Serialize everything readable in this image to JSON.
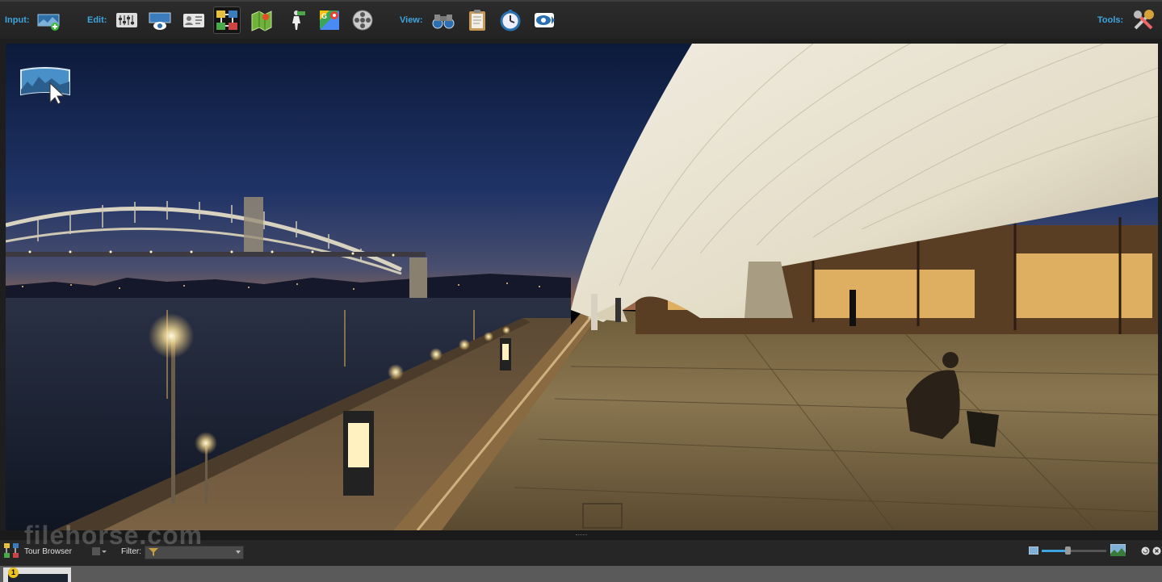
{
  "toolbar": {
    "input_label": "Input:",
    "edit_label": "Edit:",
    "view_label": "View:",
    "tools_label": "Tools:",
    "icons": [
      "add-panorama-icon",
      "properties-icon",
      "viewing-parameters-icon",
      "user-data-icon",
      "tour-map-icon",
      "floorplan-icon",
      "hotspot-icon",
      "google-maps-icon",
      "skin-icon",
      "binoculars-icon",
      "clipboard-icon",
      "timer-icon",
      "preview-icon",
      "tools-icon"
    ]
  },
  "viewer": {
    "scene": "Sydney Opera House at night with Harbour Bridge"
  },
  "tour_browser": {
    "title": "Tour Browser",
    "filter_label": "Filter:",
    "filter_value": "",
    "zoom_level": 0.4
  },
  "watermark": "filehorse.com",
  "thumbnails": [
    {
      "badge": "1"
    }
  ]
}
